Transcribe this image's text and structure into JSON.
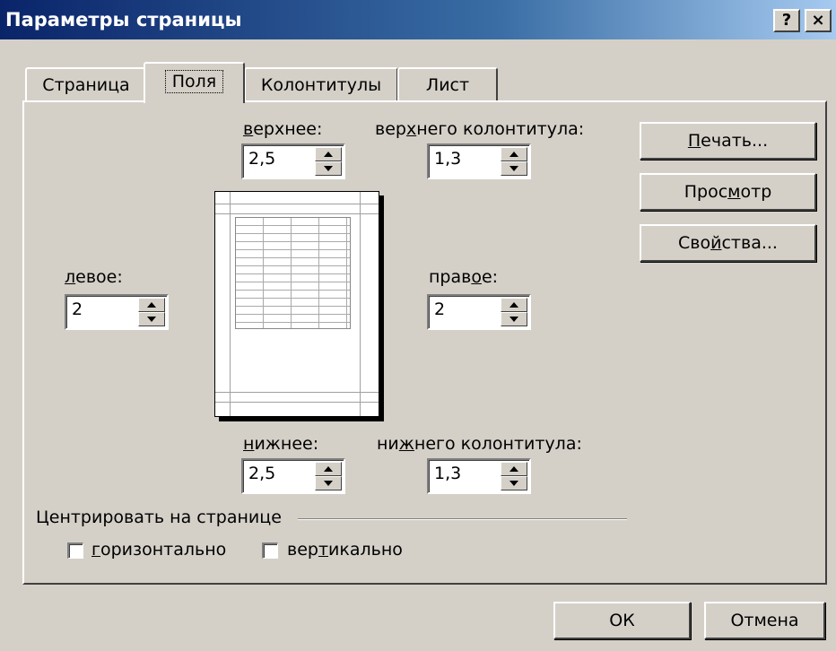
{
  "window": {
    "title": "Параметры страницы",
    "help_button": "?",
    "close_button": "×"
  },
  "tabs": [
    {
      "label": "Страница",
      "active": false
    },
    {
      "label": "Поля",
      "active": true
    },
    {
      "label": "Колонтитулы",
      "active": false
    },
    {
      "label": "Лист",
      "active": false
    }
  ],
  "margins": {
    "top": {
      "label_pre": "",
      "label_u": "в",
      "label_post": "ерхнее:",
      "value": "2,5"
    },
    "header": {
      "label_pre": "вер",
      "label_u": "х",
      "label_post": "него колонтитула:",
      "value": "1,3"
    },
    "left": {
      "label_pre": "",
      "label_u": "л",
      "label_post": "евое:",
      "value": "2"
    },
    "right": {
      "label_pre": "прав",
      "label_u": "о",
      "label_post": "е:",
      "value": "2"
    },
    "bottom": {
      "label_pre": "",
      "label_u": "н",
      "label_post": "ижнее:",
      "value": "2,5"
    },
    "footer": {
      "label_pre": "ни",
      "label_u": "ж",
      "label_post": "него колонтитула:",
      "value": "1,3"
    }
  },
  "center": {
    "group_label": "Центрировать на странице",
    "horizontal": {
      "label_pre": "",
      "label_u": "г",
      "label_post": "оризонтально",
      "checked": false
    },
    "vertical": {
      "label_pre": "вер",
      "label_u": "т",
      "label_post": "икально",
      "checked": false
    }
  },
  "side_buttons": {
    "print": {
      "label_pre": "",
      "label_u": "П",
      "label_post": "ечать..."
    },
    "preview": {
      "label_pre": "Прос",
      "label_u": "м",
      "label_post": "отр"
    },
    "properties": {
      "label_pre": "Сво",
      "label_u": "й",
      "label_post": "ства..."
    }
  },
  "footer_buttons": {
    "ok": "ОК",
    "cancel": "Отмена"
  }
}
